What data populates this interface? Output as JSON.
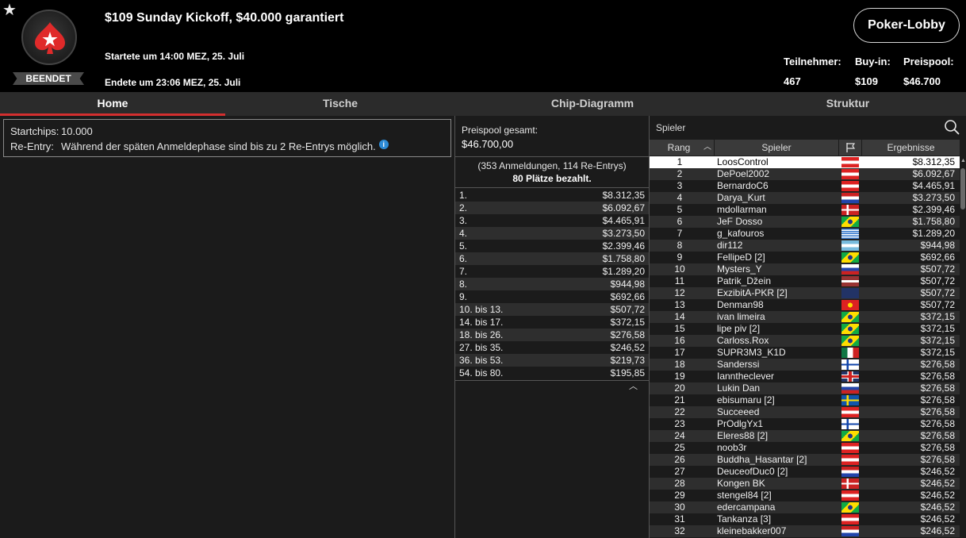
{
  "header": {
    "title": "$109 Sunday Kickoff, $40.000 garantiert",
    "started": "Startete um 14:00 MEZ, 25. Juli",
    "ended": "Endete um 23:06 MEZ, 25. Juli",
    "status": "BEENDET",
    "lobby_button": "Poker-Lobby",
    "stats": [
      {
        "label": "Teilnehmer:",
        "value": "467"
      },
      {
        "label": "Buy-in:",
        "value": "$109"
      },
      {
        "label": "Preispool:",
        "value": "$46.700"
      }
    ],
    "colors": {
      "accent": "#d32f2f"
    }
  },
  "tabs": [
    {
      "label": "Home",
      "active": true
    },
    {
      "label": "Tische",
      "active": false
    },
    {
      "label": "Chip-Diagramm",
      "active": false
    },
    {
      "label": "Struktur",
      "active": false
    }
  ],
  "info": {
    "startchips_label": "Startchips:",
    "startchips_value": "10.000",
    "reentry_label": "Re-Entry:",
    "reentry_value": "Während der späten Anmeldephase sind bis zu 2 Re-Entrys möglich.",
    "info_icon_glyph": "i"
  },
  "prizepool": {
    "label": "Preispool gesamt:",
    "value": "$46.700,00",
    "entries": "(353 Anmeldungen, 114 Re-Entrys)",
    "paid": "80 Plätze bezahlt.",
    "payouts": [
      {
        "place": "1.",
        "amount": "$8.312,35"
      },
      {
        "place": "2.",
        "amount": "$6.092,67"
      },
      {
        "place": "3.",
        "amount": "$4.465,91"
      },
      {
        "place": "4.",
        "amount": "$3.273,50"
      },
      {
        "place": "5.",
        "amount": "$2.399,46"
      },
      {
        "place": "6.",
        "amount": "$1.758,80"
      },
      {
        "place": "7.",
        "amount": "$1.289,20"
      },
      {
        "place": "8.",
        "amount": "$944,98"
      },
      {
        "place": "9.",
        "amount": "$692,66"
      },
      {
        "place": "10. bis 13.",
        "amount": "$507,72"
      },
      {
        "place": "14. bis 17.",
        "amount": "$372,15"
      },
      {
        "place": "18. bis 26.",
        "amount": "$276,58"
      },
      {
        "place": "27. bis 35.",
        "amount": "$246,52"
      },
      {
        "place": "36. bis 53.",
        "amount": "$219,73"
      },
      {
        "place": "54. bis 80.",
        "amount": "$195,85"
      }
    ]
  },
  "players": {
    "search_placeholder": "Spieler",
    "columns": {
      "rank": "Rang",
      "player": "Spieler",
      "results": "Ergebnisse"
    },
    "rows": [
      {
        "rank": "1",
        "name": "LoosControl",
        "flag": "at",
        "result": "$8.312,35",
        "selected": true
      },
      {
        "rank": "2",
        "name": "DePoel2002",
        "flag": "at",
        "result": "$6.092,67"
      },
      {
        "rank": "3",
        "name": "BernardoC6",
        "flag": "at",
        "result": "$4.465,91"
      },
      {
        "rank": "4",
        "name": "Darya_Kurt",
        "flag": "nl",
        "result": "$3.273,50"
      },
      {
        "rank": "5",
        "name": "mdollarman",
        "flag": "dk",
        "result": "$2.399,46"
      },
      {
        "rank": "6",
        "name": "JeF Dosso",
        "flag": "br",
        "result": "$1.758,80"
      },
      {
        "rank": "7",
        "name": "g_kafouros",
        "flag": "gr",
        "result": "$1.289,20"
      },
      {
        "rank": "8",
        "name": "dir112",
        "flag": "ar",
        "result": "$944,98"
      },
      {
        "rank": "9",
        "name": "FellipeD [2]",
        "flag": "br",
        "result": "$692,66"
      },
      {
        "rank": "10",
        "name": "Mysters_Y",
        "flag": "ru",
        "result": "$507,72"
      },
      {
        "rank": "11",
        "name": "Patrik_Džein",
        "flag": "lv",
        "result": "$507,72"
      },
      {
        "rank": "12",
        "name": "ExzibitA-PKR [2]",
        "flag": "nz",
        "result": "$507,72"
      },
      {
        "rank": "13",
        "name": "Denman98",
        "flag": "vn",
        "result": "$507,72"
      },
      {
        "rank": "14",
        "name": "ivan limeira",
        "flag": "br",
        "result": "$372,15"
      },
      {
        "rank": "15",
        "name": "lipe piv [2]",
        "flag": "br",
        "result": "$372,15"
      },
      {
        "rank": "16",
        "name": "Carloss.Rox",
        "flag": "br",
        "result": "$372,15"
      },
      {
        "rank": "17",
        "name": "SUPR3M3_K1D",
        "flag": "mx",
        "result": "$372,15"
      },
      {
        "rank": "18",
        "name": "Sanderssi",
        "flag": "fi",
        "result": "$276,58"
      },
      {
        "rank": "19",
        "name": "Iannthеclever",
        "flag": "gb",
        "result": "$276,58"
      },
      {
        "rank": "20",
        "name": "Lukin Dan",
        "flag": "ru",
        "result": "$276,58"
      },
      {
        "rank": "21",
        "name": "ebisumaru [2]",
        "flag": "se",
        "result": "$276,58"
      },
      {
        "rank": "22",
        "name": "Succeeed",
        "flag": "at",
        "result": "$276,58"
      },
      {
        "rank": "23",
        "name": "PrOdlgYx1",
        "flag": "fi",
        "result": "$276,58"
      },
      {
        "rank": "24",
        "name": "Eleres88 [2]",
        "flag": "br",
        "result": "$276,58"
      },
      {
        "rank": "25",
        "name": "noob3r",
        "flag": "at",
        "result": "$276,58"
      },
      {
        "rank": "26",
        "name": "Buddha_Hasantar [2]",
        "flag": "at",
        "result": "$276,58"
      },
      {
        "rank": "27",
        "name": "DeuceofDuc0 [2]",
        "flag": "nl",
        "result": "$246,52"
      },
      {
        "rank": "28",
        "name": "Kongen BK",
        "flag": "dk",
        "result": "$246,52"
      },
      {
        "rank": "29",
        "name": "stengel84 [2]",
        "flag": "at",
        "result": "$246,52"
      },
      {
        "rank": "30",
        "name": "edercampana",
        "flag": "br",
        "result": "$246,52"
      },
      {
        "rank": "31",
        "name": "Tankanza [3]",
        "flag": "at",
        "result": "$246,52"
      },
      {
        "rank": "32",
        "name": "kleinebakker007",
        "flag": "nl",
        "result": "$246,52"
      }
    ]
  }
}
